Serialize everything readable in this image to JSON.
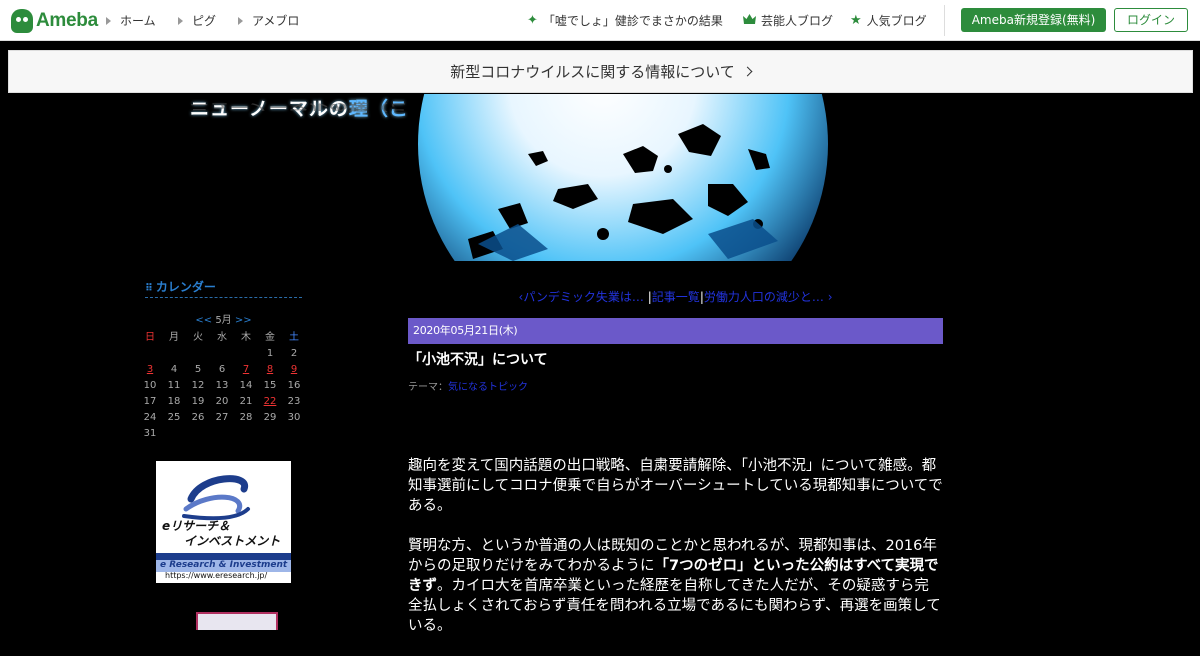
{
  "header": {
    "logo_text": "Ameba",
    "nav": [
      {
        "label": "ホーム"
      },
      {
        "label": "ピグ"
      },
      {
        "label": "アメブロ"
      }
    ],
    "trends": [
      {
        "icon": "sparkle-icon",
        "label": "「嘘でしょ」健診でまさかの結果"
      },
      {
        "icon": "crown-icon",
        "label": "芸能人ブログ"
      },
      {
        "icon": "star-icon",
        "label": "人気ブログ"
      }
    ],
    "register_label": "Ameba新規登録(無料)",
    "login_label": "ログイン",
    "accent_color": "#2d8c3c"
  },
  "notice": {
    "text": "新型コロナウイルスに関する情報について"
  },
  "blog": {
    "title_main": "ニューノーマルの",
    "title_accent": "理（ことわり）"
  },
  "sidebar": {
    "calendar_heading": "カレンダー",
    "prev": "<<",
    "month": "5月",
    "next": ">>",
    "weekdays": [
      "日",
      "月",
      "火",
      "水",
      "木",
      "金",
      "土"
    ],
    "weeks": [
      [
        "",
        "",
        "",
        "",
        "",
        "1",
        "2"
      ],
      [
        "3",
        "4",
        "5",
        "6",
        "7",
        "8",
        "9"
      ],
      [
        "10",
        "11",
        "12",
        "13",
        "14",
        "15",
        "16"
      ],
      [
        "17",
        "18",
        "19",
        "20",
        "21",
        "22",
        "23"
      ],
      [
        "24",
        "25",
        "26",
        "27",
        "28",
        "29",
        "30"
      ],
      [
        "31",
        "",
        "",
        "",
        "",
        "",
        ""
      ]
    ],
    "linked_days": [
      "3",
      "7",
      "8",
      "9",
      "22"
    ],
    "banner": {
      "jp_line1": "eリサーチ＆",
      "jp_line2": "インベストメント",
      "en": "e Research & Investment",
      "url": "https://www.eresearch.jp/"
    }
  },
  "article": {
    "prev_link": "パンデミック失業は…",
    "list_link": "記事一覧",
    "next_link": "労働力人口の減少と…",
    "sep": "|",
    "date": "2020年05月21日(木)",
    "title": "「小池不況」について",
    "theme_label": "テーマ：",
    "theme_link": "気になるトピック",
    "p1": "趣向を変えて国内話題の出口戦略、自粛要請解除、「小池不況」について雑感。都知事選前にしてコロナ便乗で自らがオーバーシュートしている現都知事についてである。",
    "p2_a": "賢明な方、というか普通の人は既知のことかと思われるが、現都知事は、2016年からの足取りだけをみてわかるように",
    "p2_bold": "「7つのゼロ」といった公約はすべて実現できず",
    "p2_b": "。カイロ大を首席卒業といった経歴を自称してきた人だが、その疑惑すら完全払しょくされておらず責任を問われる立場であるにも関わらず、再選を画策している。"
  }
}
